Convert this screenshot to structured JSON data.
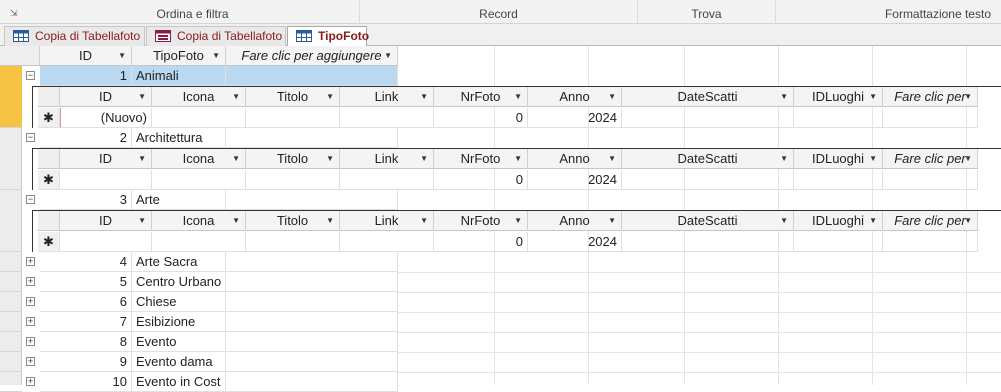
{
  "ribbon": {
    "groups": [
      {
        "label": "Ordina e filtra"
      },
      {
        "label": "Record"
      },
      {
        "label": "Trova"
      },
      {
        "label": "Formattazione testo"
      }
    ]
  },
  "tabs": [
    {
      "label": "Copia di Tabellafoto",
      "icon": "table-icon"
    },
    {
      "label": "Copia di Tabellafoto",
      "icon": "form-icon"
    },
    {
      "label": "TipoFoto",
      "icon": "table-icon",
      "active": true
    }
  ],
  "main_table": {
    "columns": [
      "ID",
      "TipoFoto",
      "Fare clic per aggiungere"
    ],
    "rows": [
      {
        "id": "1",
        "tipo": "Animali"
      },
      {
        "id": "2",
        "tipo": "Architettura"
      },
      {
        "id": "3",
        "tipo": "Arte"
      },
      {
        "id": "4",
        "tipo": "Arte Sacra"
      },
      {
        "id": "5",
        "tipo": "Centro Urbano"
      },
      {
        "id": "6",
        "tipo": "Chiese"
      },
      {
        "id": "7",
        "tipo": "Esibizione"
      },
      {
        "id": "8",
        "tipo": "Evento"
      },
      {
        "id": "9",
        "tipo": "Evento dama"
      },
      {
        "id": "10",
        "tipo": "Evento in Cost"
      }
    ]
  },
  "sub_table": {
    "columns": [
      "ID",
      "Icona",
      "Titolo",
      "Link",
      "NrFoto",
      "Anno",
      "DateScatti",
      "IDLuoghi",
      "Fare clic per"
    ],
    "new_row": {
      "id": "(Nuovo)",
      "nrfoto": "0",
      "anno": "2024",
      "marker": "✱"
    }
  },
  "colors": {
    "current_row_selector": "#f6c344",
    "highlight": "#b9d8f2",
    "tab_text": "#8b1a1a"
  }
}
